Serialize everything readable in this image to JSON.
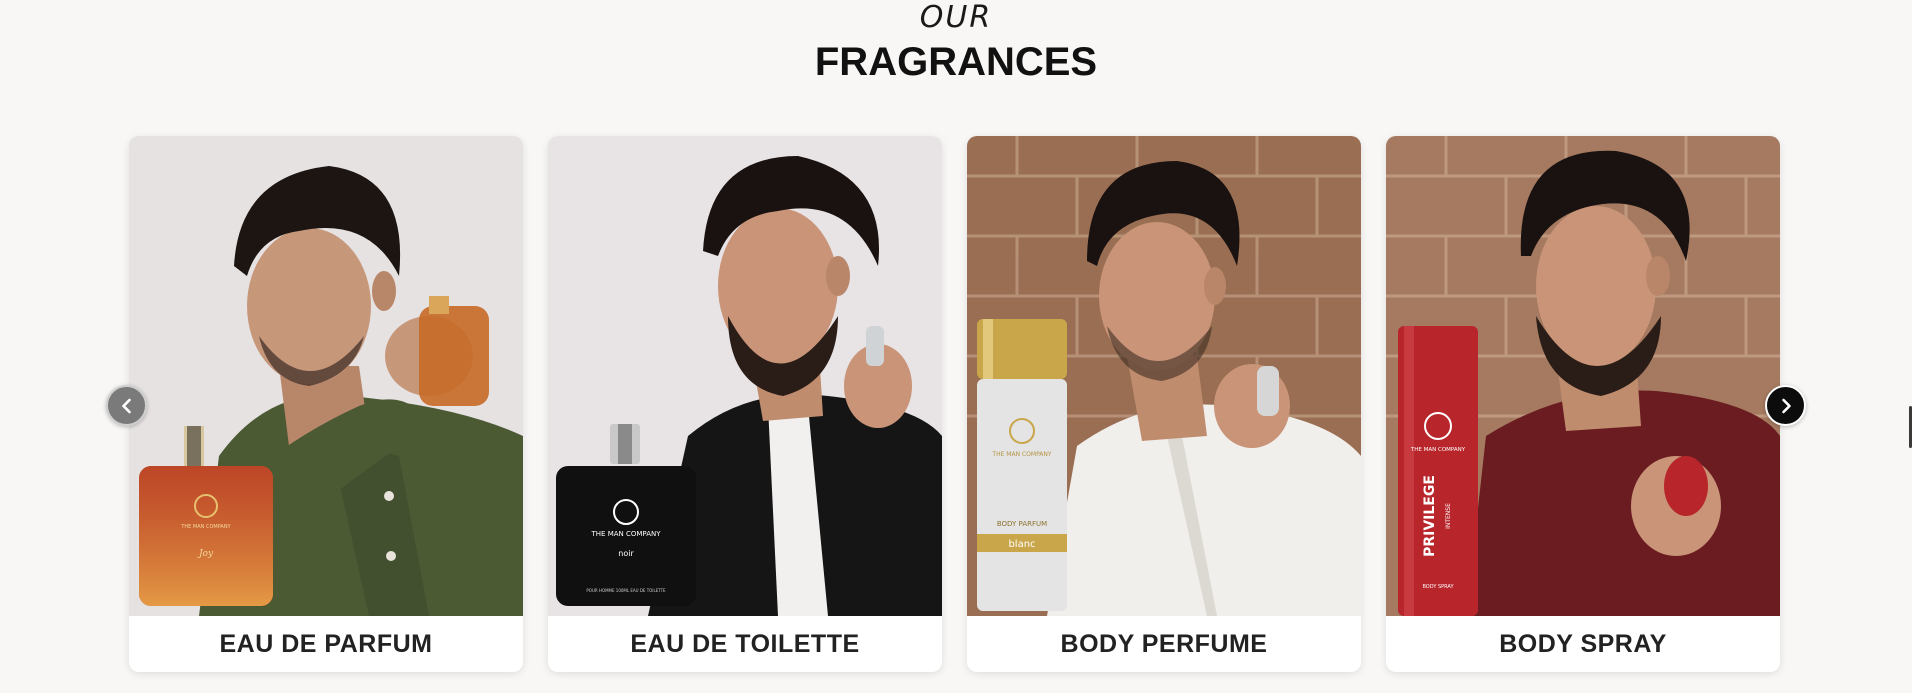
{
  "section": {
    "eyebrow": "OUR",
    "title": "FRAGRANCES"
  },
  "products": [
    {
      "label": "EAU DE PARFUM",
      "bottle_brand": "THE MAN COMPANY",
      "bottle_name": "Joy",
      "background": "#e6e2e2",
      "bottle_color": "#c4502a",
      "shirt_color": "#4c5a34"
    },
    {
      "label": "EAU DE TOILETTE",
      "bottle_brand": "THE MAN COMPANY",
      "bottle_name": "noir",
      "bottle_footer": "POUR HOMME 100ML EAU DE TOILETTE",
      "background": "#e8e3e4",
      "bottle_color": "#101010",
      "shirt_color": "#151515"
    },
    {
      "label": "BODY PERFUME",
      "bottle_brand": "THE MAN COMPANY",
      "bottle_type": "BODY PARFUM",
      "bottle_name": "blanc",
      "background": "#9a6e52",
      "bottle_color": "#e4e4e4",
      "shirt_color": "#f1efec"
    },
    {
      "label": "BODY SPRAY",
      "bottle_brand": "THE MAN COMPANY",
      "bottle_name": "PRIVILEGE",
      "bottle_sub": "INTENSE",
      "bottle_type": "BODY SPRAY",
      "background": "#a57a60",
      "bottle_color": "#b8262b",
      "shirt_color": "#6a1c20"
    }
  ],
  "carousel": {
    "prev_icon": "chevron-left-icon",
    "next_icon": "chevron-right-icon"
  }
}
